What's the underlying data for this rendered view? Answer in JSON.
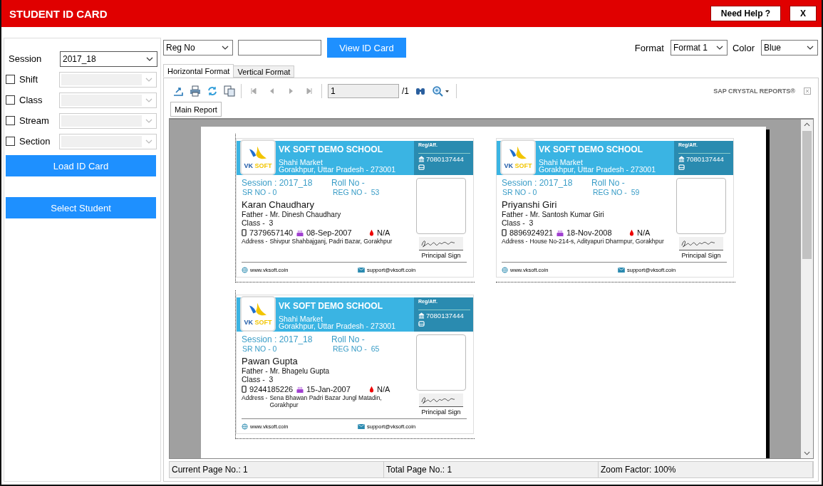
{
  "window": {
    "title": "STUDENT ID CARD",
    "help_button": "Need Help ?",
    "close_button": "X"
  },
  "filters": [
    {
      "kind": "select",
      "label": "Session",
      "value": "2017_18"
    },
    {
      "kind": "checkbox",
      "label": "Shift",
      "checked": false
    },
    {
      "kind": "checkbox",
      "label": "Class",
      "checked": false
    },
    {
      "kind": "checkbox",
      "label": "Stream",
      "checked": false
    },
    {
      "kind": "checkbox",
      "label": "Section",
      "checked": false
    }
  ],
  "actions": [
    "Load ID Card",
    "Select Student"
  ],
  "search": {
    "field": "Reg No",
    "button": "View ID Card"
  },
  "format": {
    "label": "Format",
    "value": "Format 1"
  },
  "color": {
    "label": "Color",
    "value": "Blue"
  },
  "tabs": [
    {
      "label": "Horizontal Format",
      "selected": true
    },
    {
      "label": "Vertical Format",
      "selected": false
    }
  ],
  "viewer": {
    "page": "1",
    "page_total": "/1",
    "brand": "SAP CRYSTAL REPORTS®",
    "report_tab": "Main Report"
  },
  "cards": [
    {
      "logo": [
        "VK",
        "SOFT"
      ],
      "school": "VK SOFT DEMO SCHOOL",
      "address_1": "Shahi Market",
      "address_2": "Gorakhpur, Uttar Pradesh - 273001",
      "reg_label": "Reg/Aff.",
      "school_phone": "7080137444",
      "session_label": "Session :",
      "session": "2017_18",
      "roll_label": "Roll No -",
      "sr_label": "SR NO -",
      "sr": "0",
      "reg_label_2": "REG NO -",
      "reg": "53",
      "name": "Karan Chaudhary",
      "father_label": "Father -",
      "father": "Mr. Dinesh Chaudhary",
      "class_label": "Class -",
      "class": "3",
      "mobile": "7379657140",
      "dob": "08-Sep-2007",
      "blood": "N/A",
      "address_label": "Address -",
      "address": "Shivpur Shahbajganj, Padri Bazar, Gorakhpur",
      "sign_label": "Principal Sign",
      "website": "www.vksoft.coin",
      "email": "support@vksoft.coin"
    },
    {
      "logo": [
        "VK",
        "SOFT"
      ],
      "school": "VK SOFT DEMO SCHOOL",
      "address_1": "Shahi Market",
      "address_2": "Gorakhpur, Uttar Pradesh - 273001",
      "reg_label": "Reg/Aff.",
      "school_phone": "7080137444",
      "session_label": "Session :",
      "session": "2017_18",
      "roll_label": "Roll No -",
      "sr_label": "SR NO -",
      "sr": "0",
      "reg_label_2": "REG NO -",
      "reg": "59",
      "name": "Priyanshi Giri",
      "father_label": "Father -",
      "father": "Mr. Santosh Kumar Giri",
      "class_label": "Class -",
      "class": "3",
      "mobile": "8896924921",
      "dob": "18-Nov-2008",
      "blood": "N/A",
      "address_label": "Address -",
      "address": "House No-214-s, Adityapuri Dharmpur, Gorakhpur",
      "sign_label": "Principal Sign",
      "website": "www.vksoft.coin",
      "email": "support@vksoft.coin"
    },
    {
      "logo": [
        "VK",
        "SOFT"
      ],
      "school": "VK SOFT DEMO SCHOOL",
      "address_1": "Shahi Market",
      "address_2": "Gorakhpur, Uttar Pradesh - 273001",
      "reg_label": "Reg/Aff.",
      "school_phone": "7080137444",
      "session_label": "Session :",
      "session": "2017_18",
      "roll_label": "Roll No -",
      "sr_label": "SR NO -",
      "sr": "0",
      "reg_label_2": "REG NO -",
      "reg": "65",
      "name": "Pawan Gupta",
      "father_label": "Father -",
      "father": "Mr. Bhagelu Gupta",
      "class_label": "Class -",
      "class": "3",
      "mobile": "9244185226",
      "dob": "15-Jan-2007",
      "blood": "N/A",
      "address_label": "Address -",
      "address": "Sena Bhawan Padri Bazar Jungl Matadin, Gorakhpur",
      "sign_label": "Principal Sign",
      "website": "www.vksoft.coin",
      "email": "support@vksoft.coin"
    }
  ],
  "status_bar": [
    "Current Page No.: 1",
    "Total Page No.: 1",
    "Zoom Factor: 100%"
  ]
}
